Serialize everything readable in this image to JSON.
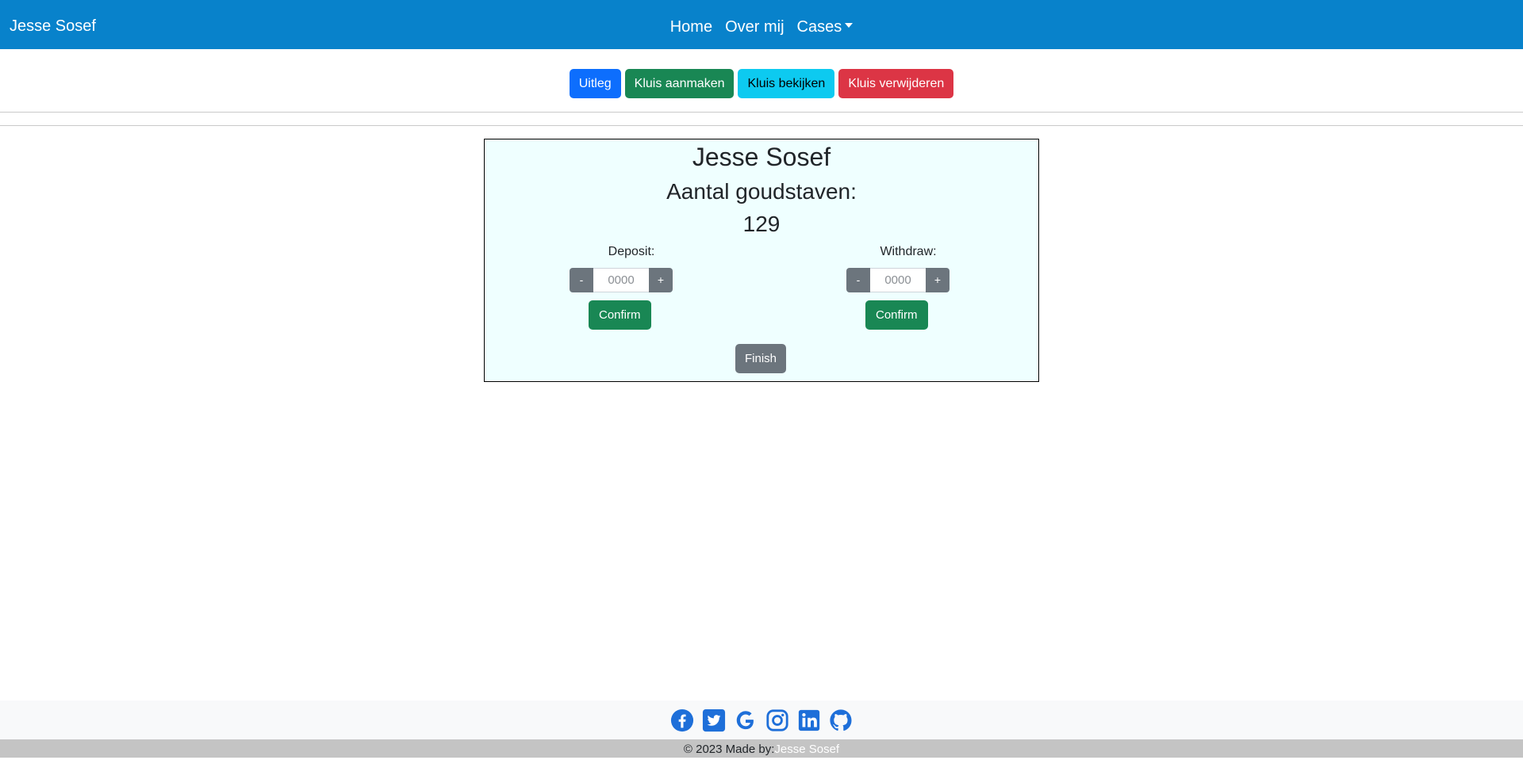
{
  "navbar": {
    "brand": "Jesse Sosef",
    "links": [
      "Home",
      "Over mij",
      "Cases"
    ]
  },
  "actions": {
    "uitleg": "Uitleg",
    "create": "Kluis aanmaken",
    "view": "Kluis bekijken",
    "delete": "Kluis verwijderen"
  },
  "vault": {
    "owner": "Jesse Sosef",
    "gold_label": "Aantal goudstaven:",
    "gold_count": "129",
    "deposit": {
      "label": "Deposit:",
      "minus": "-",
      "plus": "+",
      "placeholder": "0000",
      "confirm": "Confirm"
    },
    "withdraw": {
      "label": "Withdraw:",
      "minus": "-",
      "plus": "+",
      "placeholder": "0000",
      "confirm": "Confirm"
    },
    "finish": "Finish"
  },
  "footer": {
    "social_icons": [
      "facebook-icon",
      "twitter-icon",
      "google-icon",
      "instagram-icon",
      "linkedin-icon",
      "github-icon"
    ],
    "copyright_prefix": "© 2023 Made by:",
    "copyright_name": "Jesse Sosef"
  },
  "colors": {
    "navbar": "#0882cb",
    "card_bg": "#efffff",
    "social": "#1e6fd9"
  }
}
